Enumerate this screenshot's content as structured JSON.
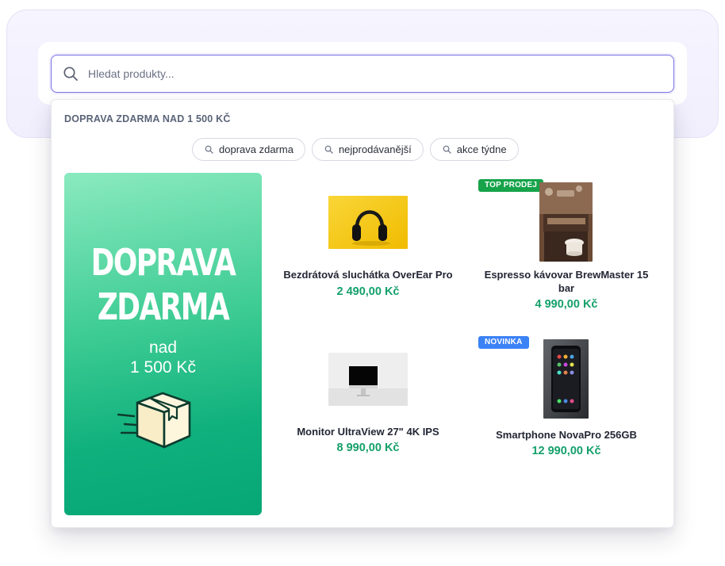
{
  "search": {
    "placeholder": "Hledat produkty..."
  },
  "dropdown": {
    "heading": "DOPRAVA ZDARMA NAD 1 500 KČ",
    "suggestions": [
      {
        "label": "doprava zdarma"
      },
      {
        "label": "nejprodávanější"
      },
      {
        "label": "akce týdne"
      }
    ]
  },
  "banner": {
    "line1": "DOPRAVA",
    "line2": "ZDARMA",
    "line3": "nad",
    "line4": "1 500 Kč",
    "icon": "delivery-box-icon"
  },
  "products": [
    {
      "name": "Bezdrátová sluchátka OverEar Pro",
      "price": "2 490,00 Kč",
      "badge": null
    },
    {
      "name": "Espresso kávovar BrewMaster 15 bar",
      "price": "4 990,00 Kč",
      "badge": "TOP PRODEJ"
    },
    {
      "name": "Monitor UltraView 27\" 4K IPS",
      "price": "8 990,00 Kč",
      "badge": null
    },
    {
      "name": "Smartphone NovaPro 256GB",
      "price": "12 990,00 Kč",
      "badge": "NOVINKA"
    }
  ],
  "colors": {
    "accent": "#7b74e6",
    "price": "#14a06b",
    "badge_top": "#16a34a",
    "badge_new": "#3b82f6",
    "banner_start": "#8aeabf",
    "banner_end": "#06a776"
  }
}
